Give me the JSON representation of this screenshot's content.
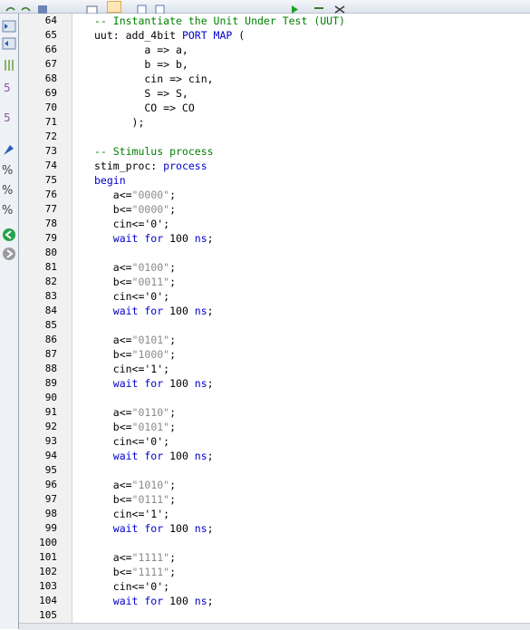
{
  "toolbar": {
    "buttons": [
      "undo-icon",
      "redo-icon",
      "save-icon",
      "open-icon",
      "cut-icon",
      "copy-icon",
      "paste-icon",
      "run-icon",
      "debug-icon",
      "build-icon"
    ]
  },
  "sidebar": {
    "buttons": [
      "indent-icon",
      "unindent-icon",
      "comment-icon",
      "uncomment-icon",
      "insert-template-icon",
      "toggle-bookmark-icon",
      "next-bookmark-icon",
      "prev-bookmark-icon",
      "clear-bookmarks-icon",
      "go-forward-icon",
      "go-back-icon"
    ]
  },
  "editor": {
    "lines": [
      {
        "n": "64",
        "t": [
          [
            "cm",
            "-- Instantiate the Unit Under Test (UUT)"
          ]
        ]
      },
      {
        "n": "65",
        "t": [
          [
            "",
            "uut: add_4bit "
          ],
          [
            "kw",
            "PORT MAP"
          ],
          [
            "",
            " ("
          ]
        ]
      },
      {
        "n": "66",
        "t": [
          [
            "",
            "        a => a,"
          ]
        ]
      },
      {
        "n": "67",
        "t": [
          [
            "",
            "        b => b,"
          ]
        ]
      },
      {
        "n": "68",
        "t": [
          [
            "",
            "        cin => cin,"
          ]
        ]
      },
      {
        "n": "69",
        "t": [
          [
            "",
            "        S => S,"
          ]
        ]
      },
      {
        "n": "70",
        "t": [
          [
            "",
            "        CO => CO"
          ]
        ]
      },
      {
        "n": "71",
        "t": [
          [
            "",
            "      );"
          ]
        ]
      },
      {
        "n": "72",
        "t": []
      },
      {
        "n": "73",
        "t": [
          [
            "cm",
            "-- Stimulus process"
          ]
        ]
      },
      {
        "n": "74",
        "t": [
          [
            "",
            "stim_proc: "
          ],
          [
            "kw",
            "process"
          ]
        ]
      },
      {
        "n": "75",
        "t": [
          [
            "kw",
            "begin"
          ]
        ]
      },
      {
        "n": "76",
        "t": [
          [
            "",
            "   a<="
          ],
          [
            "str",
            "\"0000\""
          ],
          [
            "",
            ";"
          ]
        ]
      },
      {
        "n": "77",
        "t": [
          [
            "",
            "   b<="
          ],
          [
            "str",
            "\"0000\""
          ],
          [
            "",
            ";"
          ]
        ]
      },
      {
        "n": "78",
        "t": [
          [
            "",
            "   cin<='0';"
          ]
        ]
      },
      {
        "n": "79",
        "t": [
          [
            "kw",
            "   wait for"
          ],
          [
            "",
            " 100 "
          ],
          [
            "kw",
            "ns"
          ],
          [
            "",
            ";"
          ]
        ]
      },
      {
        "n": "80",
        "t": []
      },
      {
        "n": "81",
        "t": [
          [
            "",
            "   a<="
          ],
          [
            "str",
            "\"0100\""
          ],
          [
            "",
            ";"
          ]
        ]
      },
      {
        "n": "82",
        "t": [
          [
            "",
            "   b<="
          ],
          [
            "str",
            "\"0011\""
          ],
          [
            "",
            ";"
          ]
        ]
      },
      {
        "n": "83",
        "t": [
          [
            "",
            "   cin<='0';"
          ]
        ]
      },
      {
        "n": "84",
        "t": [
          [
            "kw",
            "   wait for"
          ],
          [
            "",
            " 100 "
          ],
          [
            "kw",
            "ns"
          ],
          [
            "",
            ";"
          ]
        ]
      },
      {
        "n": "85",
        "t": []
      },
      {
        "n": "86",
        "t": [
          [
            "",
            "   a<="
          ],
          [
            "str",
            "\"0101\""
          ],
          [
            "",
            ";"
          ]
        ]
      },
      {
        "n": "87",
        "t": [
          [
            "",
            "   b<="
          ],
          [
            "str",
            "\"1000\""
          ],
          [
            "",
            ";"
          ]
        ]
      },
      {
        "n": "88",
        "t": [
          [
            "",
            "   cin<='1';"
          ]
        ]
      },
      {
        "n": "89",
        "t": [
          [
            "kw",
            "   wait for"
          ],
          [
            "",
            " 100 "
          ],
          [
            "kw",
            "ns"
          ],
          [
            "",
            ";"
          ]
        ]
      },
      {
        "n": "90",
        "t": []
      },
      {
        "n": "91",
        "t": [
          [
            "",
            "   a<="
          ],
          [
            "str",
            "\"0110\""
          ],
          [
            "",
            ";"
          ]
        ]
      },
      {
        "n": "92",
        "t": [
          [
            "",
            "   b<="
          ],
          [
            "str",
            "\"0101\""
          ],
          [
            "",
            ";"
          ]
        ]
      },
      {
        "n": "93",
        "t": [
          [
            "",
            "   cin<='0';"
          ]
        ]
      },
      {
        "n": "94",
        "t": [
          [
            "kw",
            "   wait for"
          ],
          [
            "",
            " 100 "
          ],
          [
            "kw",
            "ns"
          ],
          [
            "",
            ";"
          ]
        ]
      },
      {
        "n": "95",
        "t": []
      },
      {
        "n": "96",
        "t": [
          [
            "",
            "   a<="
          ],
          [
            "str",
            "\"1010\""
          ],
          [
            "",
            ";"
          ]
        ]
      },
      {
        "n": "97",
        "t": [
          [
            "",
            "   b<="
          ],
          [
            "str",
            "\"0111\""
          ],
          [
            "",
            ";"
          ]
        ]
      },
      {
        "n": "98",
        "t": [
          [
            "",
            "   cin<='1';"
          ]
        ]
      },
      {
        "n": "99",
        "t": [
          [
            "kw",
            "   wait for"
          ],
          [
            "",
            " 100 "
          ],
          [
            "kw",
            "ns"
          ],
          [
            "",
            ";"
          ]
        ]
      },
      {
        "n": "100",
        "t": []
      },
      {
        "n": "101",
        "t": [
          [
            "",
            "   a<="
          ],
          [
            "str",
            "\"1111\""
          ],
          [
            "",
            ";"
          ]
        ]
      },
      {
        "n": "102",
        "t": [
          [
            "",
            "   b<="
          ],
          [
            "str",
            "\"1111\""
          ],
          [
            "",
            ";"
          ]
        ]
      },
      {
        "n": "103",
        "t": [
          [
            "",
            "   cin<='0';"
          ]
        ]
      },
      {
        "n": "104",
        "t": [
          [
            "kw",
            "   wait for"
          ],
          [
            "",
            " 100 "
          ],
          [
            "kw",
            "ns"
          ],
          [
            "",
            ";"
          ]
        ]
      },
      {
        "n": "105",
        "t": []
      }
    ]
  },
  "colors": {
    "keyword": "#0000cc",
    "comment": "#008000",
    "string": "#8a8a8a",
    "gutter": "#f1f1f1"
  }
}
